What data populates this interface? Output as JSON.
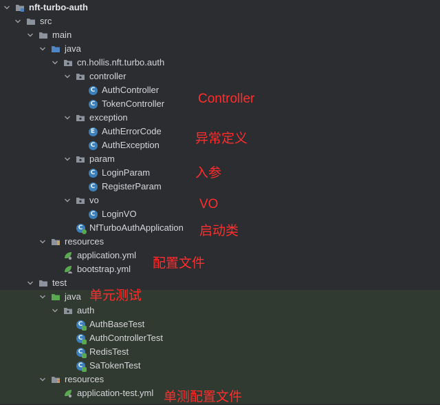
{
  "tree": {
    "project": "nft-turbo-auth",
    "src": "src",
    "main": "main",
    "main_java": "java",
    "package": "cn.hollis.nft.turbo.auth",
    "controller": "controller",
    "auth_controller": "AuthController",
    "token_controller": "TokenController",
    "exception": "exception",
    "auth_error_code": "AuthErrorCode",
    "auth_exception": "AuthException",
    "param": "param",
    "login_param": "LoginParam",
    "register_param": "RegisterParam",
    "vo": "vo",
    "login_vo": "LoginVO",
    "application_class": "NfTurboAuthApplication",
    "main_resources": "resources",
    "application_yml": "application.yml",
    "bootstrap_yml": "bootstrap.yml",
    "test": "test",
    "test_java": "java",
    "test_auth": "auth",
    "auth_base_test": "AuthBaseTest",
    "auth_controller_test": "AuthControllerTest",
    "redis_test": "RedisTest",
    "sa_token_test": "SaTokenTest",
    "test_resources": "resources",
    "application_test_yml": "application-test.yml"
  },
  "annotations": {
    "controller": "Controller",
    "exception": "异常定义",
    "param": "入参",
    "vo": "VO",
    "startup": "启动类",
    "config": "配置文件",
    "unit_test": "单元测试",
    "test_config": "单测配置文件"
  },
  "colors": {
    "background": "#2b2d30",
    "test_background": "#313a30",
    "annotation": "#ff2d2d",
    "class_icon": "#3d7fb8",
    "test_folder": "#5aa84f"
  }
}
